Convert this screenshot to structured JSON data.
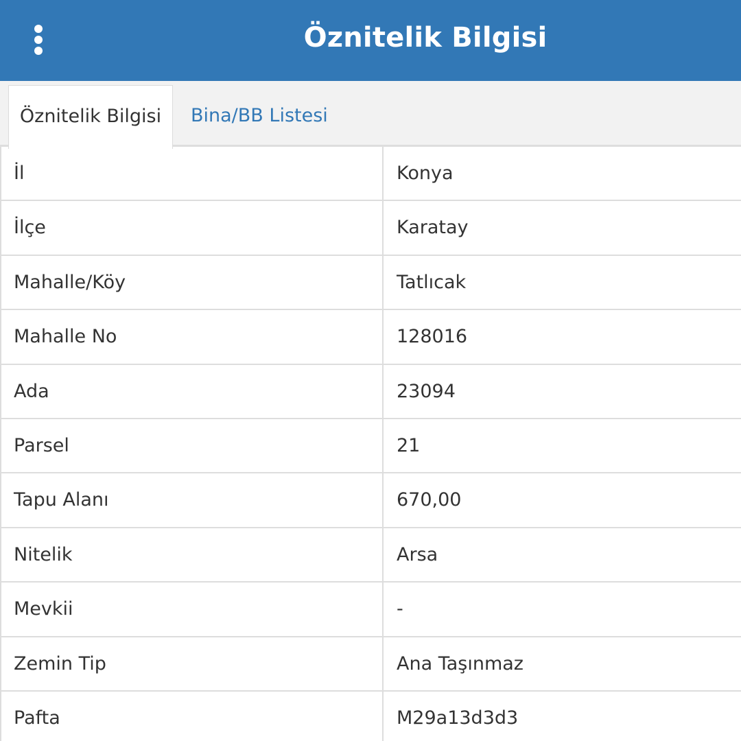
{
  "header": {
    "title": "Öznitelik Bilgisi",
    "menu_icon": "more-vertical-icon"
  },
  "tabs": [
    {
      "label": "Öznitelik Bilgisi",
      "active": true
    },
    {
      "label": "Bina/BB Listesi",
      "active": false
    }
  ],
  "colors": {
    "header_bg": "#3278b6",
    "tab_link": "#3278b6"
  },
  "attributes": [
    {
      "key": "İl",
      "value": "Konya"
    },
    {
      "key": "İlçe",
      "value": "Karatay"
    },
    {
      "key": "Mahalle/Köy",
      "value": "Tatlıcak"
    },
    {
      "key": "Mahalle No",
      "value": "128016"
    },
    {
      "key": "Ada",
      "value": "23094"
    },
    {
      "key": "Parsel",
      "value": "21"
    },
    {
      "key": "Tapu Alanı",
      "value": "670,00"
    },
    {
      "key": "Nitelik",
      "value": "Arsa"
    },
    {
      "key": "Mevkii",
      "value": "-"
    },
    {
      "key": "Zemin Tip",
      "value": "Ana Taşınmaz"
    },
    {
      "key": "Pafta",
      "value": "M29a13d3d3"
    }
  ]
}
